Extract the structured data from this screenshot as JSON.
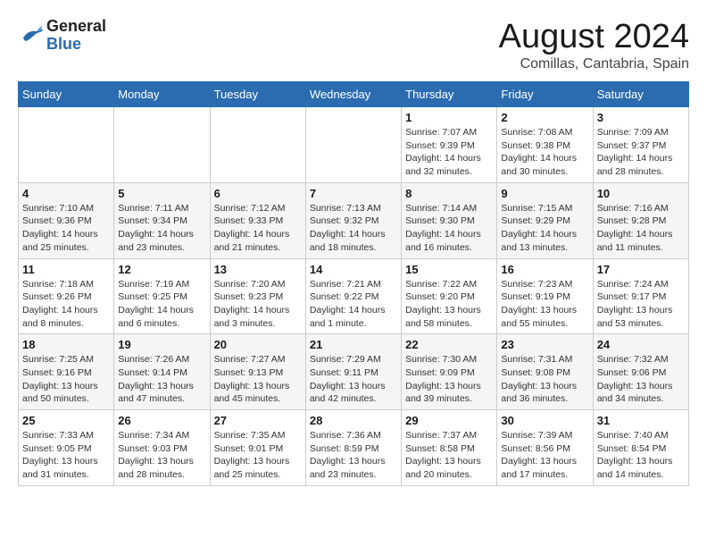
{
  "header": {
    "logo_general": "General",
    "logo_blue": "Blue",
    "month_title": "August 2024",
    "location": "Comillas, Cantabria, Spain"
  },
  "calendar": {
    "days_of_week": [
      "Sunday",
      "Monday",
      "Tuesday",
      "Wednesday",
      "Thursday",
      "Friday",
      "Saturday"
    ],
    "weeks": [
      [
        {
          "day": "",
          "info": ""
        },
        {
          "day": "",
          "info": ""
        },
        {
          "day": "",
          "info": ""
        },
        {
          "day": "",
          "info": ""
        },
        {
          "day": "1",
          "info": "Sunrise: 7:07 AM\nSunset: 9:39 PM\nDaylight: 14 hours\nand 32 minutes."
        },
        {
          "day": "2",
          "info": "Sunrise: 7:08 AM\nSunset: 9:38 PM\nDaylight: 14 hours\nand 30 minutes."
        },
        {
          "day": "3",
          "info": "Sunrise: 7:09 AM\nSunset: 9:37 PM\nDaylight: 14 hours\nand 28 minutes."
        }
      ],
      [
        {
          "day": "4",
          "info": "Sunrise: 7:10 AM\nSunset: 9:36 PM\nDaylight: 14 hours\nand 25 minutes."
        },
        {
          "day": "5",
          "info": "Sunrise: 7:11 AM\nSunset: 9:34 PM\nDaylight: 14 hours\nand 23 minutes."
        },
        {
          "day": "6",
          "info": "Sunrise: 7:12 AM\nSunset: 9:33 PM\nDaylight: 14 hours\nand 21 minutes."
        },
        {
          "day": "7",
          "info": "Sunrise: 7:13 AM\nSunset: 9:32 PM\nDaylight: 14 hours\nand 18 minutes."
        },
        {
          "day": "8",
          "info": "Sunrise: 7:14 AM\nSunset: 9:30 PM\nDaylight: 14 hours\nand 16 minutes."
        },
        {
          "day": "9",
          "info": "Sunrise: 7:15 AM\nSunset: 9:29 PM\nDaylight: 14 hours\nand 13 minutes."
        },
        {
          "day": "10",
          "info": "Sunrise: 7:16 AM\nSunset: 9:28 PM\nDaylight: 14 hours\nand 11 minutes."
        }
      ],
      [
        {
          "day": "11",
          "info": "Sunrise: 7:18 AM\nSunset: 9:26 PM\nDaylight: 14 hours\nand 8 minutes."
        },
        {
          "day": "12",
          "info": "Sunrise: 7:19 AM\nSunset: 9:25 PM\nDaylight: 14 hours\nand 6 minutes."
        },
        {
          "day": "13",
          "info": "Sunrise: 7:20 AM\nSunset: 9:23 PM\nDaylight: 14 hours\nand 3 minutes."
        },
        {
          "day": "14",
          "info": "Sunrise: 7:21 AM\nSunset: 9:22 PM\nDaylight: 14 hours\nand 1 minute."
        },
        {
          "day": "15",
          "info": "Sunrise: 7:22 AM\nSunset: 9:20 PM\nDaylight: 13 hours\nand 58 minutes."
        },
        {
          "day": "16",
          "info": "Sunrise: 7:23 AM\nSunset: 9:19 PM\nDaylight: 13 hours\nand 55 minutes."
        },
        {
          "day": "17",
          "info": "Sunrise: 7:24 AM\nSunset: 9:17 PM\nDaylight: 13 hours\nand 53 minutes."
        }
      ],
      [
        {
          "day": "18",
          "info": "Sunrise: 7:25 AM\nSunset: 9:16 PM\nDaylight: 13 hours\nand 50 minutes."
        },
        {
          "day": "19",
          "info": "Sunrise: 7:26 AM\nSunset: 9:14 PM\nDaylight: 13 hours\nand 47 minutes."
        },
        {
          "day": "20",
          "info": "Sunrise: 7:27 AM\nSunset: 9:13 PM\nDaylight: 13 hours\nand 45 minutes."
        },
        {
          "day": "21",
          "info": "Sunrise: 7:29 AM\nSunset: 9:11 PM\nDaylight: 13 hours\nand 42 minutes."
        },
        {
          "day": "22",
          "info": "Sunrise: 7:30 AM\nSunset: 9:09 PM\nDaylight: 13 hours\nand 39 minutes."
        },
        {
          "day": "23",
          "info": "Sunrise: 7:31 AM\nSunset: 9:08 PM\nDaylight: 13 hours\nand 36 minutes."
        },
        {
          "day": "24",
          "info": "Sunrise: 7:32 AM\nSunset: 9:06 PM\nDaylight: 13 hours\nand 34 minutes."
        }
      ],
      [
        {
          "day": "25",
          "info": "Sunrise: 7:33 AM\nSunset: 9:05 PM\nDaylight: 13 hours\nand 31 minutes."
        },
        {
          "day": "26",
          "info": "Sunrise: 7:34 AM\nSunset: 9:03 PM\nDaylight: 13 hours\nand 28 minutes."
        },
        {
          "day": "27",
          "info": "Sunrise: 7:35 AM\nSunset: 9:01 PM\nDaylight: 13 hours\nand 25 minutes."
        },
        {
          "day": "28",
          "info": "Sunrise: 7:36 AM\nSunset: 8:59 PM\nDaylight: 13 hours\nand 23 minutes."
        },
        {
          "day": "29",
          "info": "Sunrise: 7:37 AM\nSunset: 8:58 PM\nDaylight: 13 hours\nand 20 minutes."
        },
        {
          "day": "30",
          "info": "Sunrise: 7:39 AM\nSunset: 8:56 PM\nDaylight: 13 hours\nand 17 minutes."
        },
        {
          "day": "31",
          "info": "Sunrise: 7:40 AM\nSunset: 8:54 PM\nDaylight: 13 hours\nand 14 minutes."
        }
      ]
    ]
  }
}
